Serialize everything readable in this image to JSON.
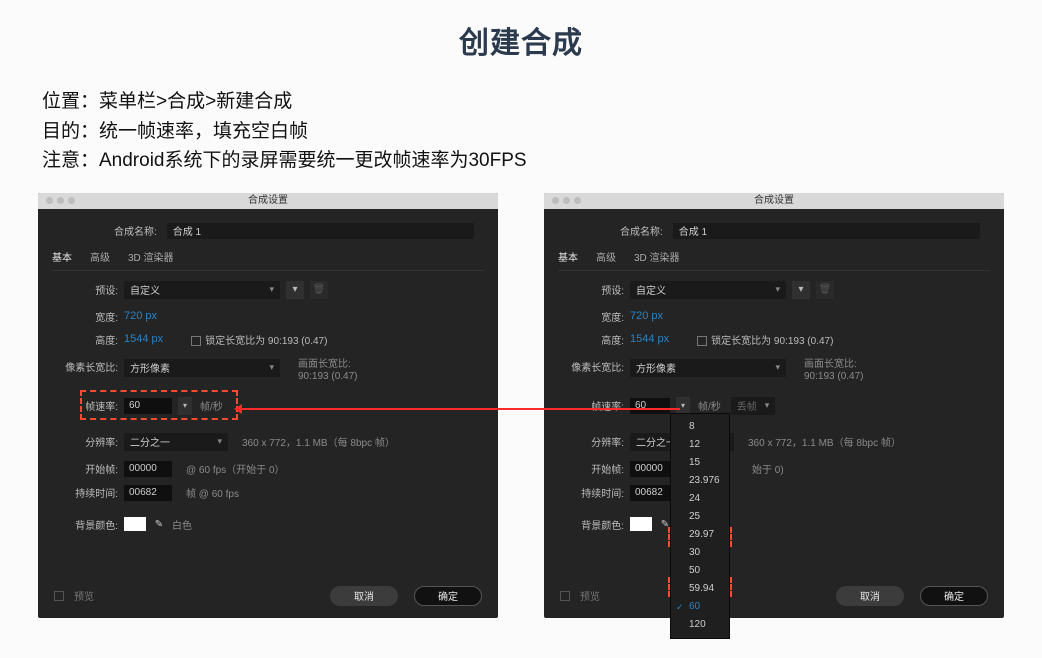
{
  "title": "创建合成",
  "intro": {
    "l1": "位置：菜单栏>合成>新建合成",
    "l2": "目的：统一帧速率，填充空白帧",
    "l3": "注意：Android系统下的录屏需要统一更改帧速率为30FPS"
  },
  "dialog": {
    "title": "合成设置",
    "name_label": "合成名称:",
    "name_value": "合成 1",
    "tabs": {
      "basic": "基本",
      "advanced": "高级",
      "renderer": "3D 渲染器"
    },
    "preset_label": "预设:",
    "preset_value": "自定义",
    "width_label": "宽度:",
    "width_value": "720 px",
    "height_label": "高度:",
    "height_value": "1544 px",
    "lock_label": "锁定长宽比为 90:193 (0.47)",
    "par_label": "像素长宽比:",
    "par_value": "方形像素",
    "frame_aspect_l1": "画面长宽比:",
    "frame_aspect_l2": "90:193 (0.47)",
    "fps_label": "帧速率:",
    "fps_value": "60",
    "fps_unit": "帧/秒",
    "dropframe": "丢帧",
    "res_label": "分辨率:",
    "res_value": "二分之一",
    "res_info": "360 x 772，1.1 MB（每 8bpc 帧）",
    "start_label": "开始帧:",
    "start_value": "00000",
    "start_info": "@ 60 fps（开始于 0）",
    "start_info2": "始于 0)",
    "dur_label": "持续时间:",
    "dur_value": "00682",
    "dur_info": "帧 @ 60 fps",
    "bg_label": "背景颜色:",
    "bg_name": "白色",
    "preview": "预览",
    "cancel": "取消",
    "ok": "确定"
  },
  "framerate_options": [
    "8",
    "12",
    "15",
    "23.976",
    "24",
    "25",
    "29.97",
    "30",
    "50",
    "59.94",
    "60",
    "120"
  ]
}
